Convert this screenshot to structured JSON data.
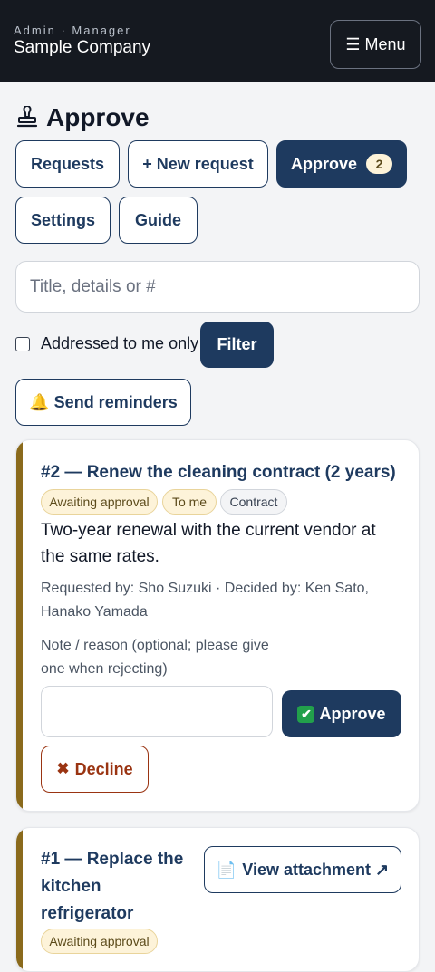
{
  "header": {
    "role_line": "Admin · Manager",
    "company": "Sample Company",
    "menu_label": "☰ Menu"
  },
  "page": {
    "title": "Approve"
  },
  "nav": {
    "requests": "Requests",
    "new_request": "+ New request",
    "approve": "Approve",
    "approve_count": "2",
    "settings": "Settings",
    "guide": "Guide"
  },
  "search": {
    "placeholder": "Title, details or #",
    "value": ""
  },
  "filters": {
    "addressed_to_me_label": "Addressed to me only",
    "addressed_to_me_checked": false,
    "filter_button": "Filter",
    "send_reminders": "🔔 Send reminders"
  },
  "requests": [
    {
      "title": "#2 — Renew the cleaning contract (2 years)",
      "status": "Awaiting approval",
      "assignee_tag": "To me",
      "category": "Contract",
      "description": "Two-year renewal with the current vendor at the same rates.",
      "meta": "Requested by: Sho Suzuki · Decided by: Ken Sato, Hanako Yamada",
      "note_label": "Note / reason (optional; please give one when rejecting)",
      "note_value": "",
      "approve_label": "Approve",
      "decline_label": "Decline"
    },
    {
      "title": "#1 — Replace the kitchen refrigerator",
      "status": "Awaiting approval",
      "attachment_label": "View attachment ↗"
    }
  ],
  "colors": {
    "header_bg": "#151920",
    "primary": "#1e3a5f",
    "accent_bar": "#8a6a1c",
    "decline": "#9a3412",
    "badge_bg": "#fdf3d9"
  }
}
